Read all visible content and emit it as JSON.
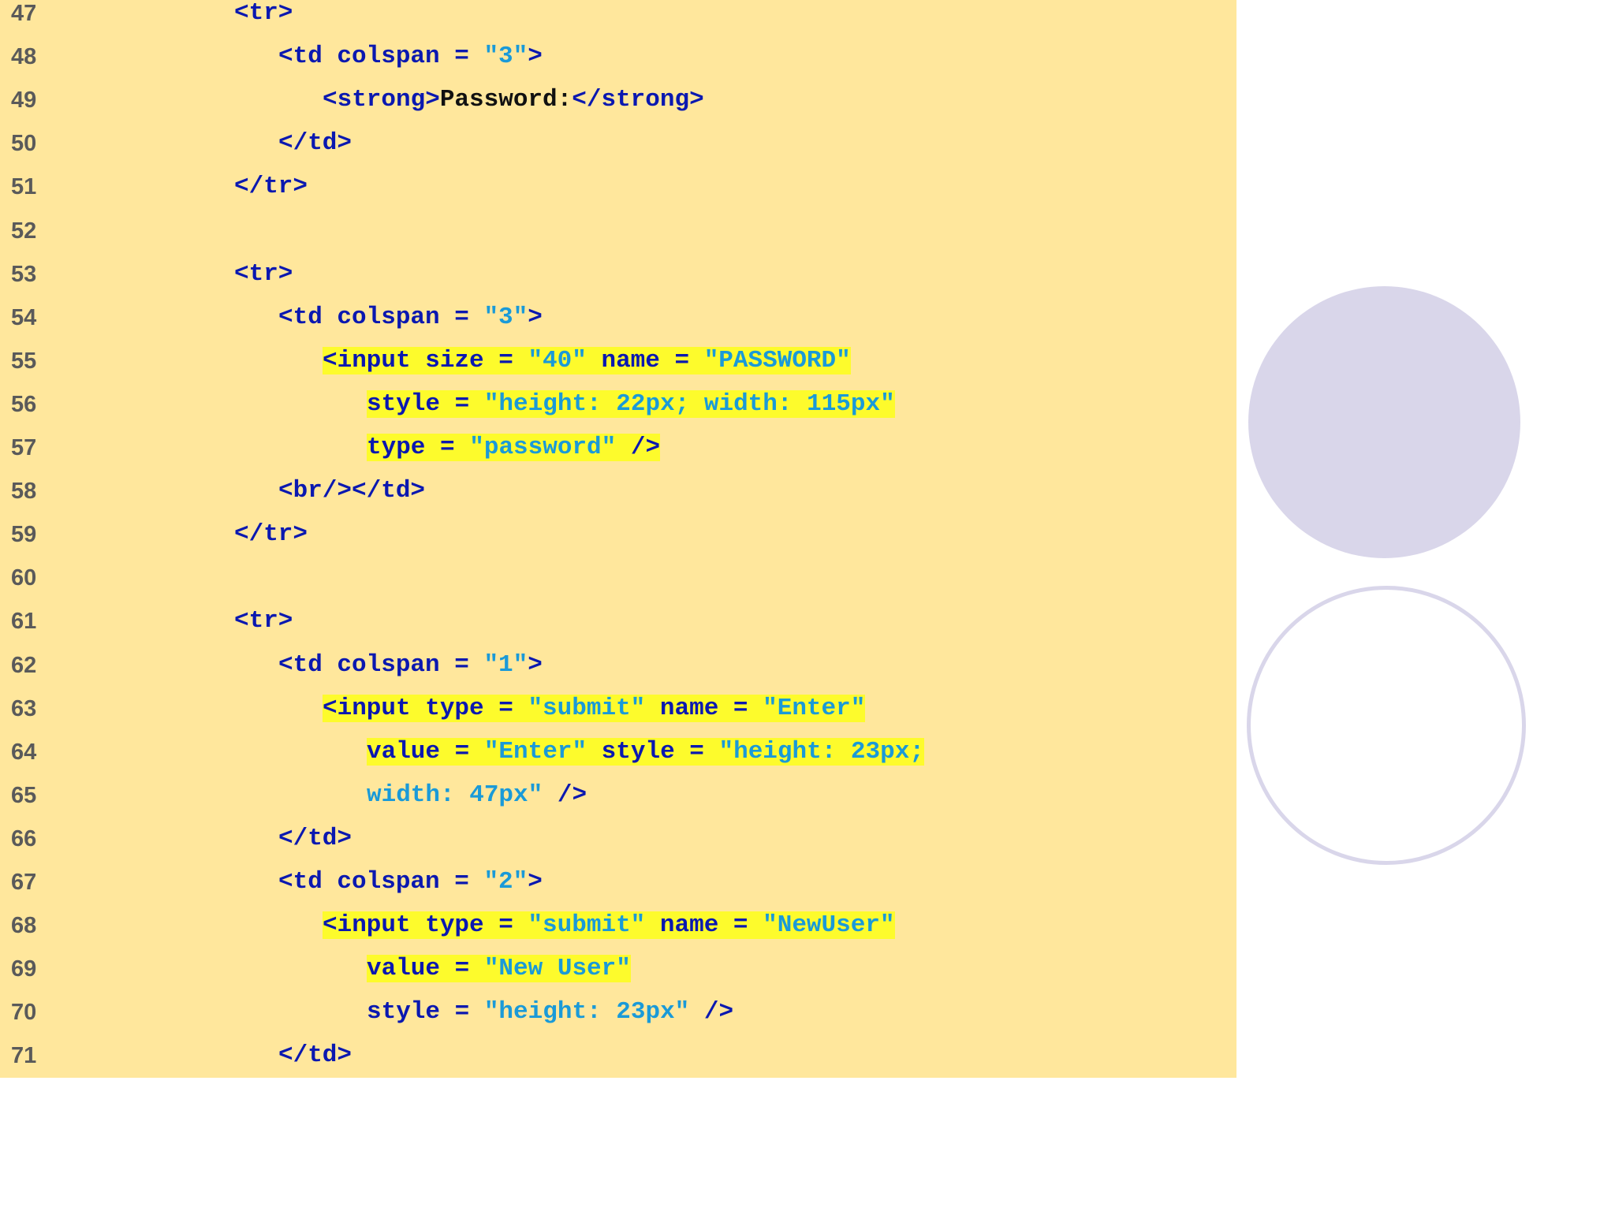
{
  "lines": [
    {
      "number": "47",
      "indent": 0,
      "segments": [
        {
          "t": "<tr>",
          "c": "tag"
        }
      ]
    },
    {
      "number": "48",
      "indent": 1,
      "segments": [
        {
          "t": "<td colspan = ",
          "c": "tag"
        },
        {
          "t": "\"3\"",
          "c": "str"
        },
        {
          "t": ">",
          "c": "tag"
        }
      ]
    },
    {
      "number": "49",
      "indent": 2,
      "segments": [
        {
          "t": "<strong>",
          "c": "tag"
        },
        {
          "t": "Password:",
          "c": "txt"
        },
        {
          "t": "</strong>",
          "c": "tag"
        }
      ]
    },
    {
      "number": "50",
      "indent": 1,
      "segments": [
        {
          "t": "</td>",
          "c": "tag"
        }
      ]
    },
    {
      "number": "51",
      "indent": 0,
      "segments": [
        {
          "t": "</tr>",
          "c": "tag"
        }
      ]
    },
    {
      "number": "52",
      "indent": 0,
      "segments": []
    },
    {
      "number": "53",
      "indent": 0,
      "segments": [
        {
          "t": "<tr>",
          "c": "tag"
        }
      ]
    },
    {
      "number": "54",
      "indent": 1,
      "segments": [
        {
          "t": "<td colspan = ",
          "c": "tag"
        },
        {
          "t": "\"3\"",
          "c": "str"
        },
        {
          "t": ">",
          "c": "tag"
        }
      ]
    },
    {
      "number": "55",
      "indent": 2,
      "segments": [
        {
          "t": "<input size = ",
          "c": "tag",
          "hl": true
        },
        {
          "t": "\"40\"",
          "c": "str",
          "hl": true
        },
        {
          "t": " name = ",
          "c": "tag",
          "hl": true
        },
        {
          "t": "\"PASSWORD\"",
          "c": "str",
          "hl": true
        }
      ]
    },
    {
      "number": "56",
      "indent": 3,
      "segments": [
        {
          "t": "style = ",
          "c": "tag",
          "hl": true
        },
        {
          "t": "\"height: 22px; width: 115px\"",
          "c": "str",
          "hl": true
        }
      ]
    },
    {
      "number": "57",
      "indent": 3,
      "segments": [
        {
          "t": "type = ",
          "c": "tag",
          "hl": true
        },
        {
          "t": "\"password\"",
          "c": "str",
          "hl": true
        },
        {
          "t": " />",
          "c": "tag",
          "hl": true
        }
      ]
    },
    {
      "number": "58",
      "indent": 1,
      "segments": [
        {
          "t": "<br/></td>",
          "c": "tag"
        }
      ]
    },
    {
      "number": "59",
      "indent": 0,
      "segments": [
        {
          "t": "</tr>",
          "c": "tag"
        }
      ]
    },
    {
      "number": "60",
      "indent": 0,
      "segments": []
    },
    {
      "number": "61",
      "indent": 0,
      "segments": [
        {
          "t": "<tr>",
          "c": "tag"
        }
      ]
    },
    {
      "number": "62",
      "indent": 1,
      "segments": [
        {
          "t": "<td colspan = ",
          "c": "tag"
        },
        {
          "t": "\"1\"",
          "c": "str"
        },
        {
          "t": ">",
          "c": "tag"
        }
      ]
    },
    {
      "number": "63",
      "indent": 2,
      "segments": [
        {
          "t": "<input type = ",
          "c": "tag",
          "hl": true
        },
        {
          "t": "\"submit\"",
          "c": "str",
          "hl": true
        },
        {
          "t": " name = ",
          "c": "tag",
          "hl": true
        },
        {
          "t": "\"Enter\"",
          "c": "str",
          "hl": true
        }
      ]
    },
    {
      "number": "64",
      "indent": 3,
      "segments": [
        {
          "t": "value = ",
          "c": "tag",
          "hl": true
        },
        {
          "t": "\"Enter\"",
          "c": "str",
          "hl": true
        },
        {
          "t": " style = ",
          "c": "tag",
          "hl": true
        },
        {
          "t": "\"height: 23px;",
          "c": "str",
          "hl": true
        }
      ]
    },
    {
      "number": "65",
      "indent": 3,
      "segments": [
        {
          "t": "width: 47px\"",
          "c": "str"
        },
        {
          "t": " />",
          "c": "tag"
        }
      ]
    },
    {
      "number": "66",
      "indent": 1,
      "segments": [
        {
          "t": "</td>",
          "c": "tag"
        }
      ]
    },
    {
      "number": "67",
      "indent": 1,
      "segments": [
        {
          "t": "<td colspan = ",
          "c": "tag"
        },
        {
          "t": "\"2\"",
          "c": "str"
        },
        {
          "t": ">",
          "c": "tag"
        }
      ]
    },
    {
      "number": "68",
      "indent": 2,
      "segments": [
        {
          "t": "<input type = ",
          "c": "tag",
          "hl": true
        },
        {
          "t": "\"submit\"",
          "c": "str",
          "hl": true
        },
        {
          "t": " name = ",
          "c": "tag",
          "hl": true
        },
        {
          "t": "\"NewUser\"",
          "c": "str",
          "hl": true
        }
      ]
    },
    {
      "number": "69",
      "indent": 3,
      "segments": [
        {
          "t": "value = ",
          "c": "tag",
          "hl": true
        },
        {
          "t": "\"New User\"",
          "c": "str",
          "hl": true
        }
      ]
    },
    {
      "number": "70",
      "indent": 3,
      "segments": [
        {
          "t": "style = ",
          "c": "tag"
        },
        {
          "t": "\"height: 23px\"",
          "c": "str"
        },
        {
          "t": " />",
          "c": "tag"
        }
      ]
    },
    {
      "number": "71",
      "indent": 1,
      "segments": [
        {
          "t": "</td>",
          "c": "tag"
        }
      ]
    }
  ],
  "colors": {
    "panel_background": "#ffe79c",
    "tag": "#0a18b0",
    "string": "#1a9ad8",
    "text": "#111111",
    "highlight": "#fdfb2c",
    "line_number": "#5a5a5a",
    "decor_circle": "#d9d6ea"
  }
}
